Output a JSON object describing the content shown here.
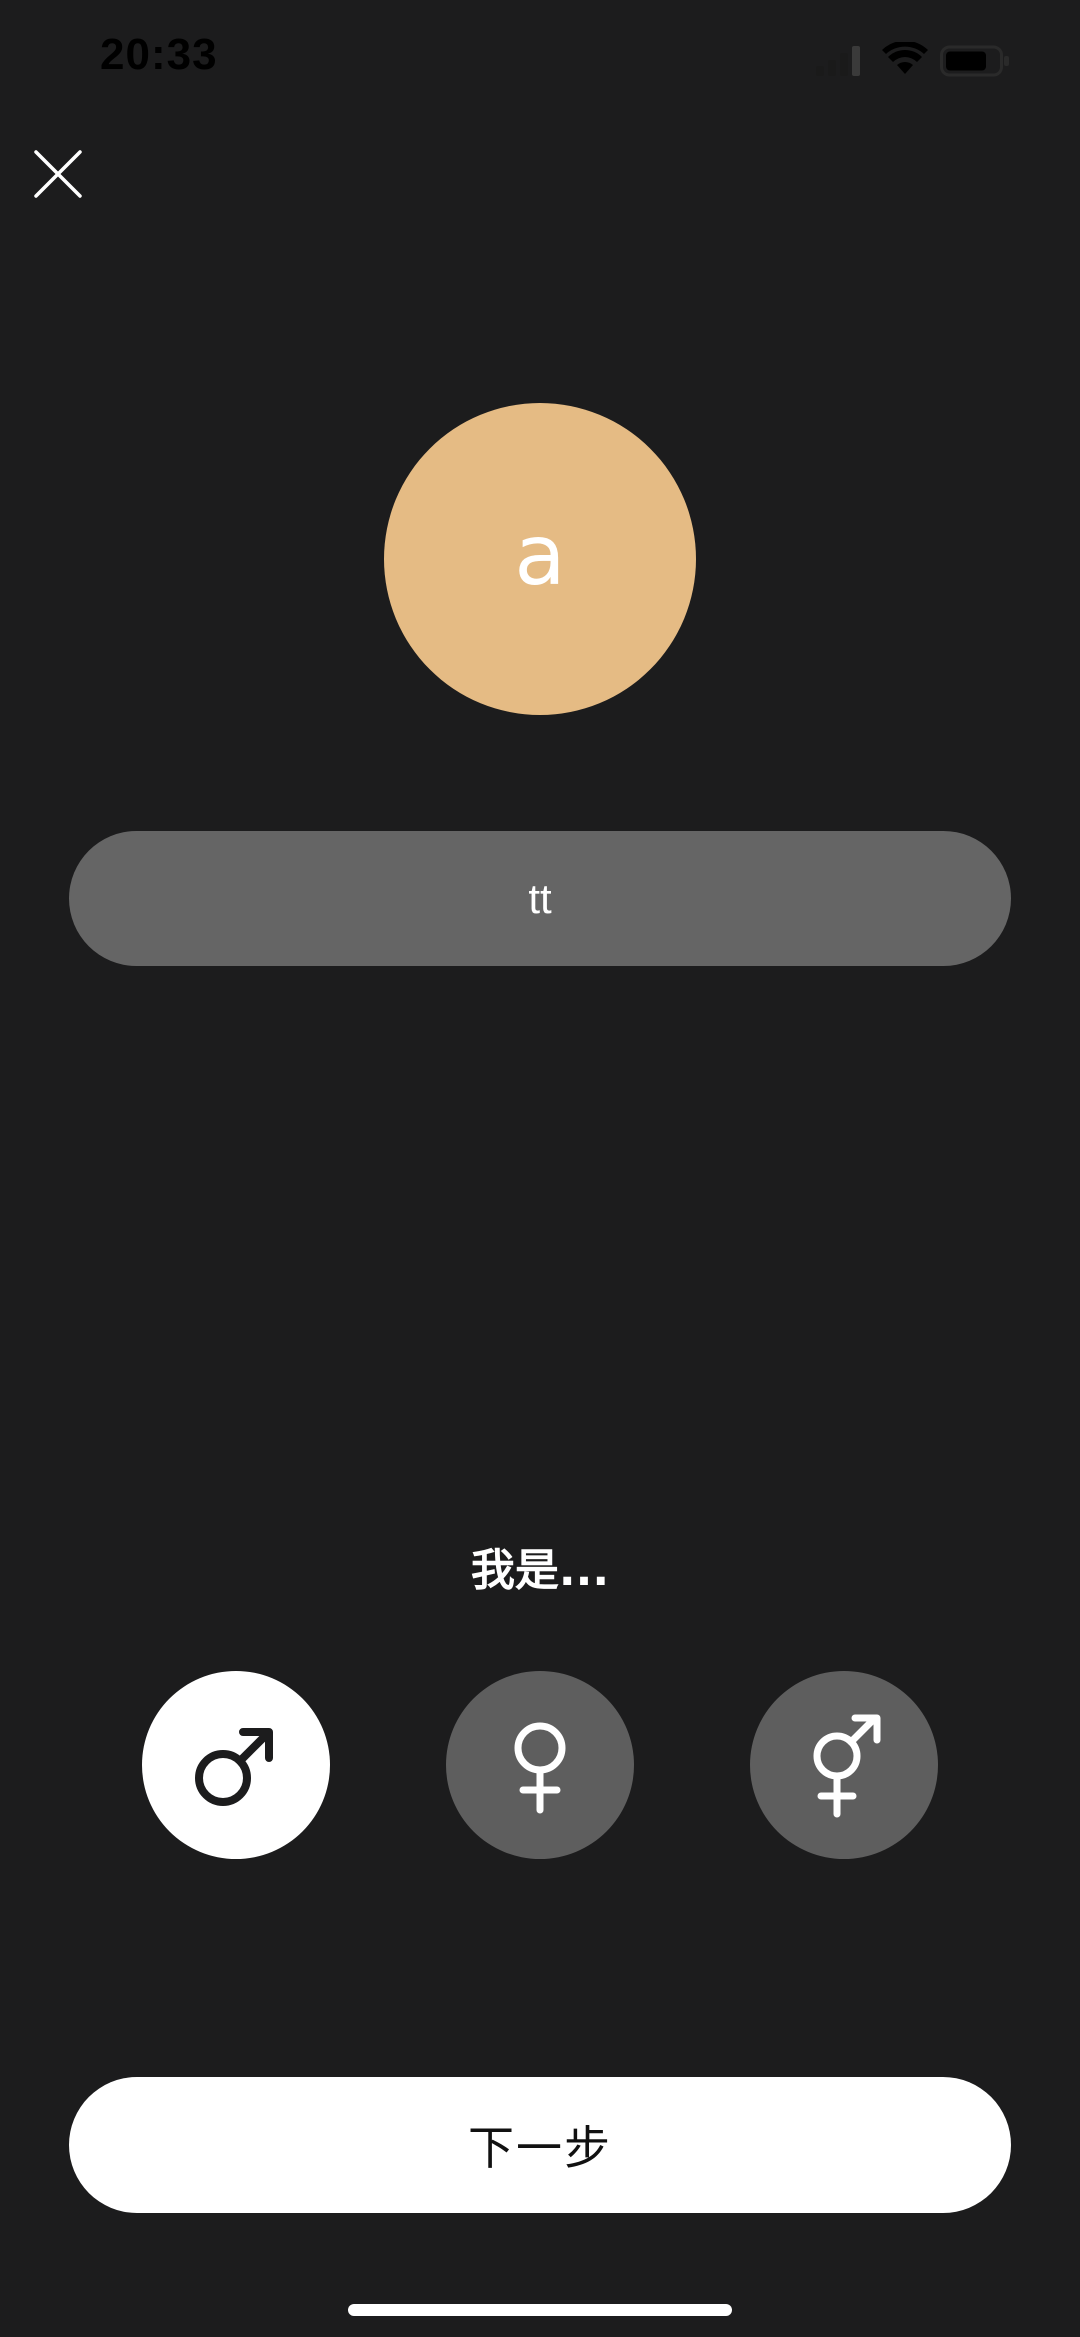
{
  "status_bar": {
    "time": "20:33"
  },
  "profile": {
    "avatar_initial": "a",
    "avatar_color": "#e5bb84",
    "name_value": "tt"
  },
  "gender": {
    "prompt": "我是...",
    "options": [
      {
        "icon": "male-symbol-icon",
        "selected": true
      },
      {
        "icon": "female-symbol-icon",
        "selected": false
      },
      {
        "icon": "transgender-symbol-icon",
        "selected": false
      }
    ]
  },
  "actions": {
    "next_label": "下一步"
  },
  "colors": {
    "background": "#1c1c1d",
    "field_bg": "#656565",
    "option_unselected": "#5e5e5e",
    "option_selected": "#ffffff"
  }
}
